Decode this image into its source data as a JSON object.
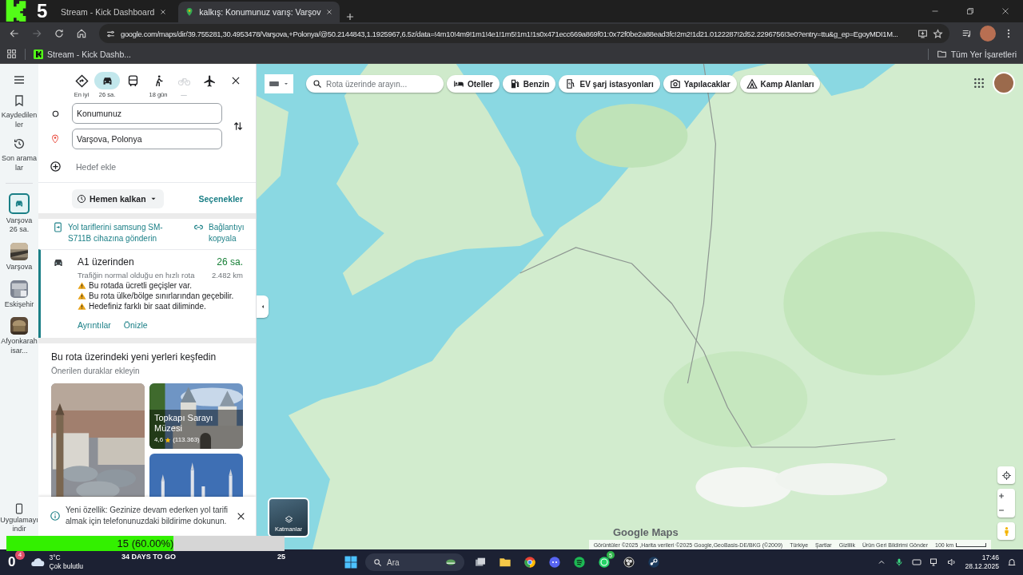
{
  "stream_overlay": {
    "logo_count": "5",
    "progress": {
      "text": "15 (60.00%)",
      "level": 0.6
    },
    "countdown": "34 DAYS TO GO",
    "number": "25",
    "counter": "0"
  },
  "browser": {
    "tabs": [
      {
        "kind": "kick",
        "title": "Stream - Kick Dashboard",
        "selected": false
      },
      {
        "kind": "maps",
        "title": "kalkış: Konumunuz varış: Varşov",
        "selected": true
      }
    ],
    "url": "google.com/maps/dir/39.755281,30.4953478/Varşova,+Polonya/@50.2144843,1.1925967,6.5z/data=!4m10!4m9!1m1!4e1!1m5!1m1!1s0x471ecc669a869f01:0x72f0be2a88ead3fc!2m2!1d21.0122287!2d52.2296756!3e0?entry=ttu&g_ep=EgoyMDI1M...",
    "bookmarks": [
      "Stream - Kick Dashb..."
    ],
    "all_bookmarks": "Tüm Yer İşaretleri"
  },
  "rail": {
    "items": [
      {
        "kind": "saved",
        "label": "Kaydedilenler"
      },
      {
        "kind": "recent",
        "label": "Son aramalar"
      }
    ],
    "trips": [
      {
        "kind": "route",
        "label": "Varşova",
        "sublabel": "26 sa.",
        "selected": true
      },
      {
        "kind": "place",
        "label": "Varşova",
        "selected": false
      },
      {
        "kind": "place",
        "label": "Eskişehir",
        "selected": false
      },
      {
        "kind": "place",
        "label": "Afyonkarahisar...",
        "selected": false
      }
    ],
    "download": "Uygulamayı indir"
  },
  "directions": {
    "modes": [
      {
        "kind": "best",
        "label": "En iyi",
        "selected": false,
        "disabled": false
      },
      {
        "kind": "car",
        "label": "26 sa.",
        "selected": true,
        "disabled": false
      },
      {
        "kind": "transit",
        "selected": false,
        "disabled": false
      },
      {
        "kind": "walk",
        "label": "18 gün",
        "selected": false,
        "disabled": false
      },
      {
        "kind": "bike",
        "label": "—",
        "selected": false,
        "disabled": true
      },
      {
        "kind": "flight",
        "selected": false,
        "disabled": false
      }
    ],
    "origin": "Konumunuz",
    "destination": "Varşova, Polonya",
    "add_stop": "Hedef ekle",
    "depart": "Hemen kalkan",
    "options": "Seçenekler",
    "send_to_phone": "Yol tariflerini samsung SM-S711B cihazına gönderin",
    "copy_link": "Bağlantıyı kopyala",
    "route": {
      "title": "A1 üzerinden",
      "duration": "26 sa.",
      "description": "Trafiğin normal olduğu en hızlı rota",
      "distance": "2.482 km",
      "warnings": [
        "Bu rotada ücretli geçişler var.",
        "Bu rota ülke/bölge sınırlarından geçebilir.",
        "Hedefiniz farklı bir saat diliminde."
      ],
      "links": [
        "Ayrıntılar",
        "Önizle"
      ]
    },
    "explore": {
      "title": "Bu rota üzerindeki yeni yerleri keşfedin",
      "subtitle": "Önerilen duraklar ekleyin",
      "cards": [
        {
          "kind": "picture"
        },
        {
          "kind": "picture",
          "name": "Topkapı Sarayı Müzesi",
          "rating": "4,6",
          "reviews": "(113.363)"
        },
        {
          "kind": "picture"
        }
      ]
    },
    "notice": "Yeni özellik: Gezinize devam ederken yol tarifi almak için telefonunuzdaki bildirime dokunun."
  },
  "map": {
    "search": {
      "placeholder": "Rota üzerinde arayın..."
    },
    "chips": [
      {
        "kind": "hotel",
        "label": "Oteller"
      },
      {
        "kind": "fuel",
        "label": "Benzin"
      },
      {
        "kind": "ev",
        "label": "EV şarj istasyonları"
      },
      {
        "kind": "camera",
        "label": "Yapılacaklar"
      },
      {
        "kind": "camp",
        "label": "Kamp Alanları"
      }
    ],
    "layers": "Katmanlar",
    "logo": "Google Maps",
    "attribution": [
      "Görüntüler ©2025 ,Harita verileri ©2025 Google,GeoBasis-DE/BKG (©2009)",
      "Türkiye",
      "Şartlar",
      "Gizlilik",
      "Ürün Geri Bildirimi Gönder"
    ],
    "scale": "100 km"
  },
  "taskbar": {
    "weather": {
      "badge": "4",
      "temperature": "3°C",
      "condition": "Çok bulutlu"
    },
    "search": "Ara",
    "apps": [
      {
        "kind": "taskview"
      },
      {
        "kind": "folder"
      },
      {
        "kind": "chrome"
      },
      {
        "kind": "discord"
      },
      {
        "kind": "spotify"
      },
      {
        "kind": "whatsapp",
        "badge": "5"
      },
      {
        "kind": "obs"
      },
      {
        "kind": "steam"
      }
    ],
    "time": "17:46",
    "date": "28.12.2025"
  }
}
